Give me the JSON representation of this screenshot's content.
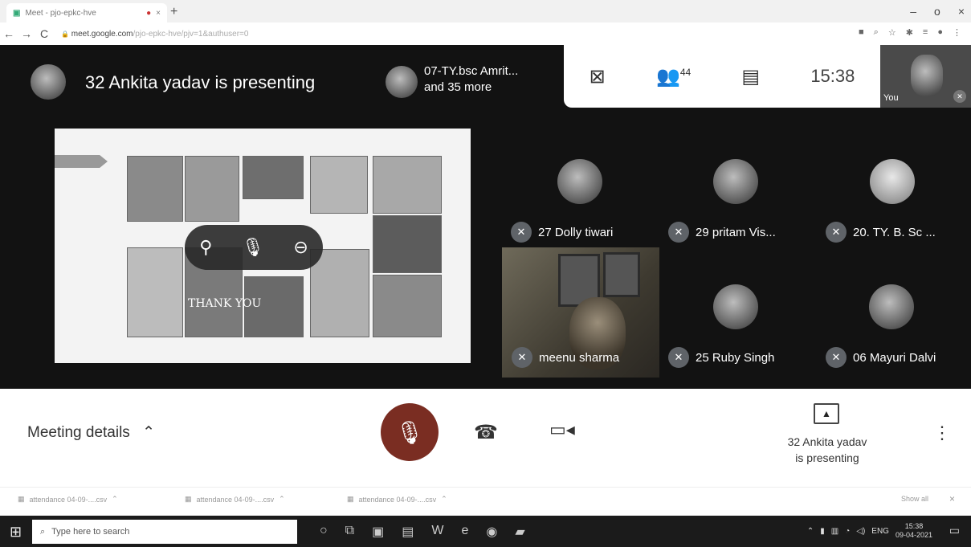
{
  "browser": {
    "tab_title": "Meet - pjo-epkc-hve",
    "tab_recording_icon": "recording-dot-icon",
    "url_host": "meet.google.com",
    "url_rest": "/pjo-epkc-hve/pjv=1&authuser=0",
    "nav": {
      "back": "←",
      "forward": "→",
      "reload": "C"
    },
    "window_controls": {
      "minimize": "–",
      "maximize": "o",
      "close": "×"
    }
  },
  "meet": {
    "presenter_banner": "32 Ankita yadav is presenting",
    "others_line1": "07-TY.bsc Amrit...",
    "others_line2": "and 35 more",
    "participants_count": "44",
    "clock": "15:38",
    "self_label": "You",
    "participants": [
      {
        "name": "27 Dolly tiwari"
      },
      {
        "name": "29 pritam Vis..."
      },
      {
        "name": "20. TY. B. Sc ..."
      },
      {
        "name": "meenu sharma"
      },
      {
        "name": "25 Ruby Singh"
      },
      {
        "name": "06 Mayuri Dalvi"
      }
    ],
    "slide_text": {
      "thank_you": "THANK YOU"
    },
    "hover_controls": [
      "pin-icon",
      "mic-icon",
      "remove-icon"
    ]
  },
  "controls": {
    "meeting_details": "Meeting details",
    "present_line1": "32 Ankita yadav",
    "present_line2": "is presenting"
  },
  "downloads": {
    "items": [
      "attendance 04-09-....csv",
      "attendance 04-09-....csv",
      "attendance 04-09-....csv"
    ],
    "show_all": "Show all"
  },
  "taskbar": {
    "search_placeholder": "Type here to search",
    "lang": "ENG",
    "time": "15:38",
    "date": "09-04-2021"
  }
}
